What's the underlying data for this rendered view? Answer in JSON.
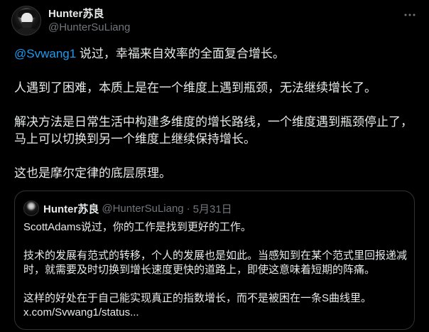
{
  "author": {
    "display_name": "Hunter苏良",
    "handle": "@HunterSuLiang"
  },
  "more_icon": "more-horizontal-icon",
  "tweet": {
    "mention": "@Svwang1",
    "line1_rest": " 说过，幸福来自效率的全面复合增长。",
    "para2": "人遇到了困难，本质上是在一个维度上遇到瓶颈，无法继续增长了。",
    "para3_line1": "解决方法是日常生活中构建多维度的增长路线，一个维度遇到瓶颈停止了，",
    "para3_line2": "马上可以切换到另一个维度上继续保持增长。",
    "para4": "这也是摩尔定律的底层原理。"
  },
  "quote": {
    "display_name": "Hunter苏良",
    "handle": "@HunterSuLiang",
    "dot": "·",
    "date": "5月31日",
    "para1": "ScottAdams说过，你的工作是找到更好的工作。",
    "para2_line1": "技术的发展有范式的转移，个人的发展也是如此。当感知到在某个范式里回报递减",
    "para2_line2": "时，就需要及时切换到增长速度更快的道路上，即使这意味着短期的阵痛。",
    "para3": "这样的好处在于自己能实现真正的指数增长，而不是被困在一条S曲线里。",
    "link": "x.com/Svwang1/status..."
  },
  "colors": {
    "background": "#000000",
    "text": "#e7e9ea",
    "secondary": "#71767b",
    "link": "#1d9bf0",
    "border": "#2f3336"
  }
}
